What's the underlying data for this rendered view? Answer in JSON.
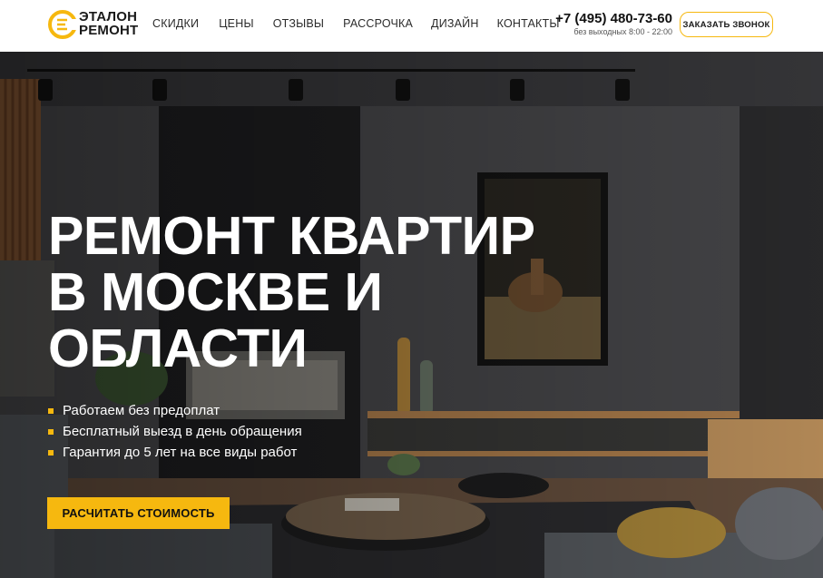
{
  "brand": {
    "line1": "ЭТАЛОН",
    "line2": "РЕМОНТ",
    "accent": "#f6b80f"
  },
  "nav": {
    "items": [
      {
        "label": "СКИДКИ"
      },
      {
        "label": "ЦЕНЫ"
      },
      {
        "label": "ОТЗЫВЫ"
      },
      {
        "label": "РАССРОЧКА"
      },
      {
        "label": "ДИЗАЙН"
      },
      {
        "label": "КОНТАКТЫ"
      }
    ]
  },
  "contact": {
    "phone": "+7 (495) 480-73-60",
    "hours": "без выходных 8:00 - 22:00",
    "callback_label": "ЗАКАЗАТЬ ЗВОНОК"
  },
  "hero": {
    "title_lines": [
      "РЕМОНТ КВАРТИР",
      "В МОСКВЕ И",
      "ОБЛАСТИ"
    ],
    "bullets": [
      "Работаем без предоплат",
      "Бесплатный выезд в день обращения",
      "Гарантия до 5 лет на все виды работ"
    ],
    "cta_label": "РАСЧИТАТЬ СТОИМОСТЬ"
  },
  "icons": {
    "logo": "logo-mark-icon",
    "bullet": "square-bullet-icon"
  }
}
